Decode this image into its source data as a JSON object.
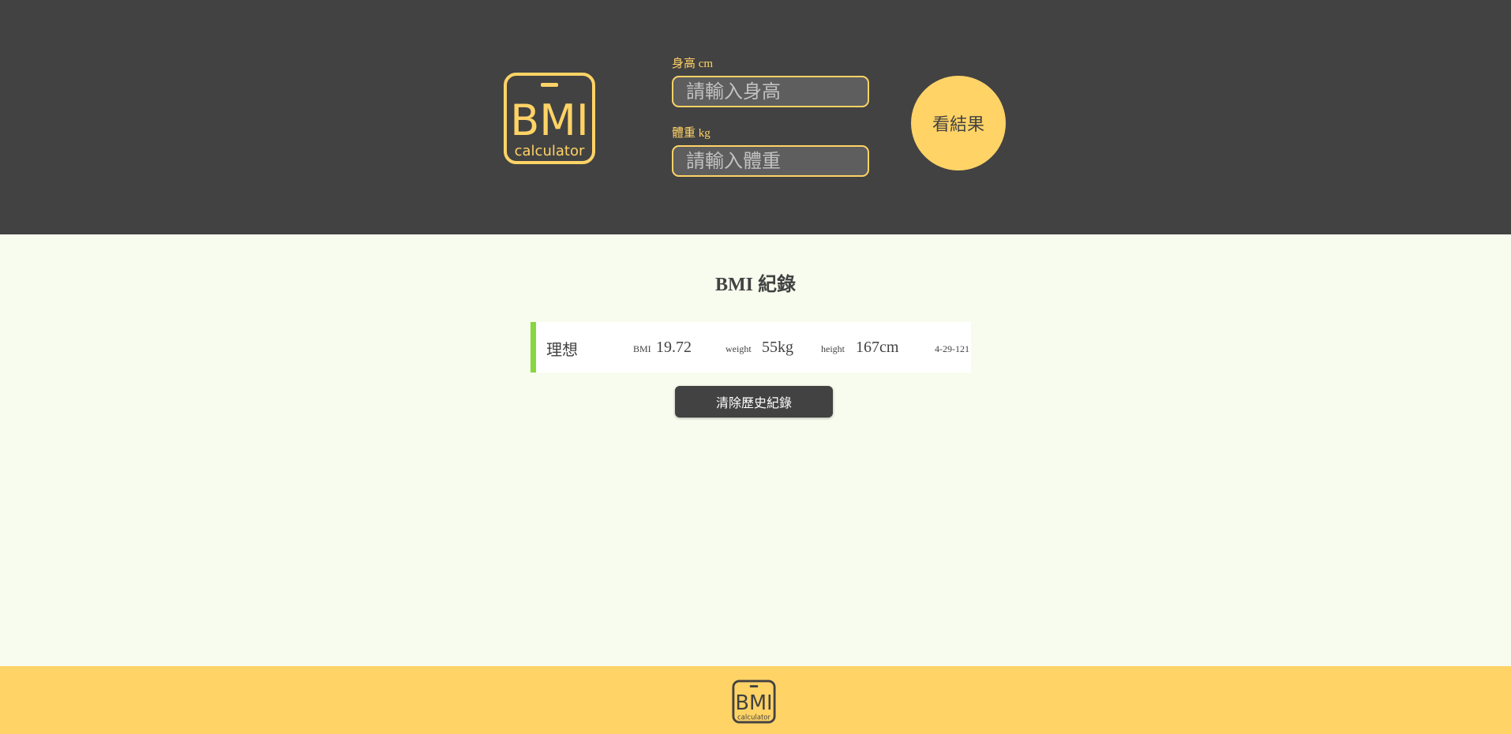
{
  "header": {
    "logo": {
      "text": "BMI",
      "subtext": "calculator",
      "icon": "bmi-logo"
    },
    "height_field": {
      "label": "身高 cm",
      "placeholder": "請輸入身高",
      "value": ""
    },
    "weight_field": {
      "label": "體重 kg",
      "placeholder": "請輸入體重",
      "value": ""
    },
    "result_button": {
      "label": "看結果"
    }
  },
  "records": {
    "title": "BMI 紀錄",
    "items": [
      {
        "status": "理想",
        "status_color": "#86D73F",
        "bmi_label": "BMI",
        "bmi_value": "19.72",
        "weight_label": "weight",
        "weight_value": "55kg",
        "height_label": "height",
        "height_value": "167cm",
        "date": "4-29-121"
      }
    ],
    "clear_button": {
      "label": "清除歷史紀錄"
    }
  },
  "footer": {
    "logo": {
      "text": "BMI",
      "subtext": "calculator",
      "icon": "bmi-logo"
    }
  },
  "colors": {
    "header_bg": "#424242",
    "accent": "#FFD366",
    "page_bg": "#F8FCEE",
    "ideal": "#86D73F"
  }
}
